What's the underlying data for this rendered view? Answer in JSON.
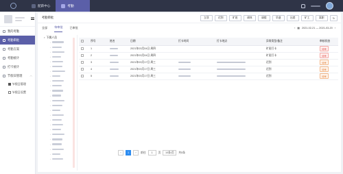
{
  "topbar": {
    "tabs": [
      {
        "label": "配薪中心",
        "active": false
      },
      {
        "label": "考勤",
        "active": true
      }
    ]
  },
  "sidebar": {
    "items": [
      {
        "label": "我的考勤",
        "active": false
      },
      {
        "label": "考勤审批",
        "active": true
      },
      {
        "label": "考勤方案",
        "active": false
      },
      {
        "label": "考勤统计",
        "active": false
      },
      {
        "label": "打卡统计",
        "active": false
      },
      {
        "label": "节假日管理",
        "active": false,
        "expandable": true
      }
    ],
    "subitems": [
      {
        "label": "节假日管理"
      },
      {
        "label": "节假日设置"
      }
    ]
  },
  "main": {
    "title": "考勤审批",
    "toolbar": [
      "立项",
      "迟到",
      "旷班",
      "调休",
      "请假",
      "早退",
      "出差",
      "矿工",
      "离职"
    ],
    "tabs": [
      {
        "label": "全部",
        "active": false
      },
      {
        "label": "待审批",
        "active": true
      },
      {
        "label": "已审批",
        "active": false
      }
    ],
    "date_range": "2021-02-21 — 2021-03-20"
  },
  "tree": {
    "root_label": "下属人员"
  },
  "table": {
    "columns": [
      "序号",
      "姓名",
      "日期",
      "打卡时间",
      "打卡地点",
      "异常类型/备注",
      "审核状态"
    ],
    "rows": [
      {
        "index": "1",
        "date": "2021年03月04日 周四",
        "type": "旷班打卡",
        "status": "待审",
        "status_color": "red"
      },
      {
        "index": "2",
        "date": "2021年03月04日 周四",
        "type": "旷班打卡",
        "status": "待审",
        "status_color": "red"
      },
      {
        "index": "3",
        "date": "2021年03月17日 周三",
        "type": "迟到",
        "status": "待审",
        "status_color": "orange"
      },
      {
        "index": "4",
        "date": "2021年03月17日 周三",
        "type": "迟到",
        "status": "待审",
        "status_color": "orange"
      },
      {
        "index": "5",
        "date": "2021年03月17日 周三",
        "type": "迟到",
        "status": "待审",
        "status_color": "orange"
      }
    ]
  },
  "pagination": {
    "current_page": "1",
    "goto_label": "前往",
    "goto_value": "1",
    "page_unit": "页",
    "page_size": "10条/页",
    "total": "共5条"
  }
}
